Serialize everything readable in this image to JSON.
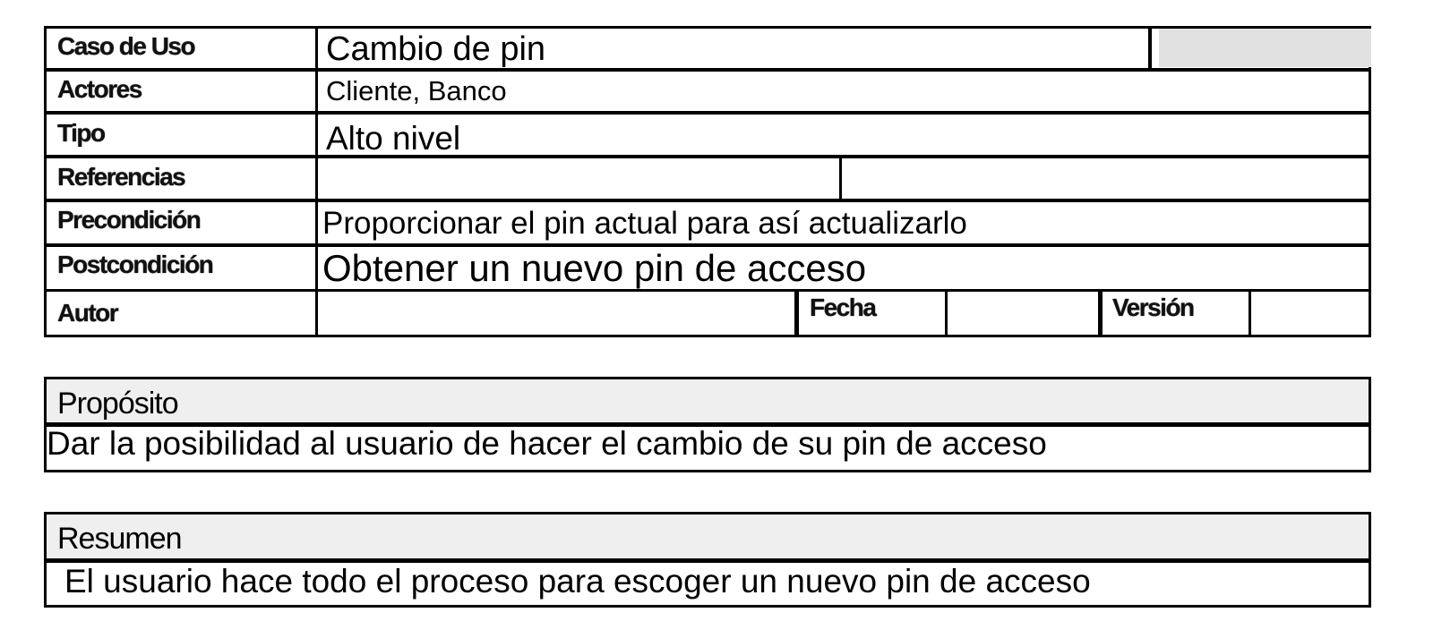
{
  "rows": {
    "caso_de_uso": {
      "label": "Caso de Uso",
      "value": "Cambio de pin"
    },
    "actores": {
      "label": "Actores",
      "value": "Cliente, Banco"
    },
    "tipo": {
      "label": "Tipo",
      "value": "Alto nivel"
    },
    "referencias": {
      "label": "Referencias",
      "value": ""
    },
    "precondicion": {
      "label": "Precondición",
      "value": "Proporcionar el pin actual para así actualizarlo"
    },
    "postcondicion": {
      "label": "Postcondición",
      "value": "Obtener un nuevo pin de acceso"
    },
    "autor": {
      "label": "Autor",
      "value": "",
      "fecha_label": "Fecha",
      "fecha_value": "",
      "version_label": "Versión",
      "version_value": ""
    }
  },
  "proposito": {
    "title": "Propósito",
    "text": "Dar la posibilidad al usuario de hacer el cambio de su pin de acceso"
  },
  "resumen": {
    "title": "Resumen",
    "text": "El usuario hace todo el proceso para escoger un nuevo pin de acceso"
  }
}
